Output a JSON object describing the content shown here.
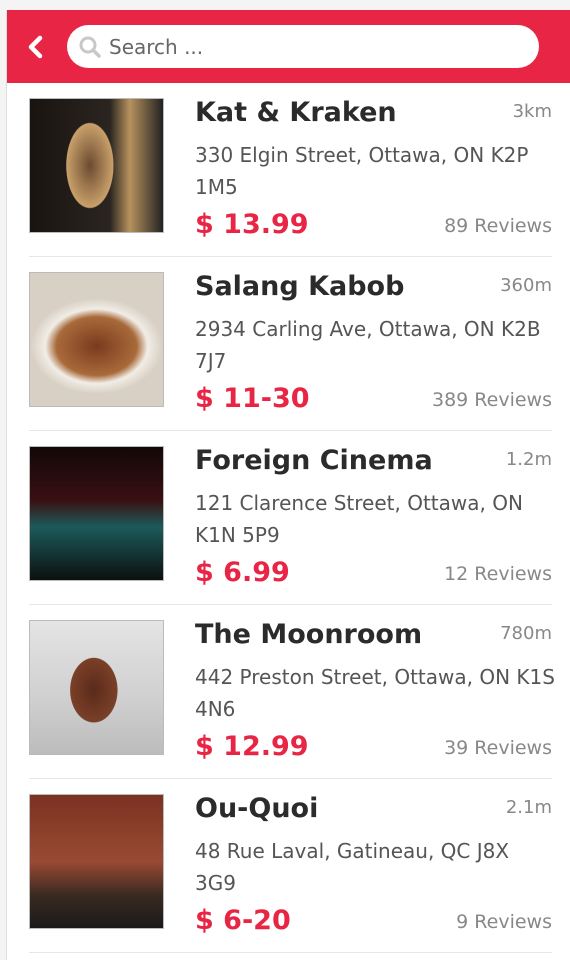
{
  "header": {
    "search_placeholder": "Search ..."
  },
  "colors": {
    "accent": "#e82544"
  },
  "restaurants": [
    {
      "name": "Kat & Kraken",
      "distance": "3km",
      "address": "330 Elgin Street, Ottawa, ON K2P 1M5",
      "price": "$ 13.99",
      "reviews": "89 Reviews"
    },
    {
      "name": "Salang Kabob",
      "distance": "360m",
      "address": "2934 Carling Ave, Ottawa, ON K2B 7J7",
      "price": "$ 11-30",
      "reviews": "389 Reviews"
    },
    {
      "name": "Foreign Cinema",
      "distance": "1.2m",
      "address": "121 Clarence Street, Ottawa, ON K1N 5P9",
      "price": "$ 6.99",
      "reviews": "12 Reviews"
    },
    {
      "name": "The Moonroom",
      "distance": "780m",
      "address": "442 Preston Street, Ottawa, ON K1S 4N6",
      "price": "$ 12.99",
      "reviews": "39 Reviews"
    },
    {
      "name": "Ou-Quoi",
      "distance": "2.1m",
      "address": "48 Rue Laval, Gatineau, QC J8X 3G9",
      "price": "$ 6-20",
      "reviews": "9 Reviews"
    }
  ]
}
